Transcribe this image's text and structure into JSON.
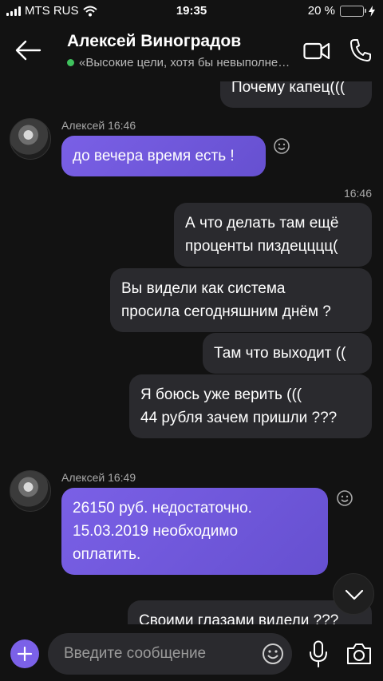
{
  "status_bar": {
    "carrier": "MTS RUS",
    "time": "19:35",
    "battery_percent_label": "20 %",
    "battery_level": 0.2
  },
  "header": {
    "contact_name": "Алексей Виноградов",
    "status_text": "«Высокие цели, хотя бы невыполне…",
    "online_color": "#3fc15d"
  },
  "messages": [
    {
      "direction": "outgoing",
      "text": "Почему капец((("
    },
    {
      "direction": "incoming",
      "sender": "Алексей",
      "time": "16:46",
      "text": "до вечера время есть !"
    },
    {
      "direction": "outgoing",
      "time": "16:46",
      "text": "А что делать там ещё\nпроценты пиздецццц("
    },
    {
      "direction": "outgoing",
      "text": "Вы видели как система\nпросила сегодняшним днём ?"
    },
    {
      "direction": "outgoing",
      "text": "Там что выходит (("
    },
    {
      "direction": "outgoing",
      "text": "Я боюсь уже верить (((\n44 рубля зачем пришли ???"
    },
    {
      "direction": "incoming",
      "sender": "Алексей",
      "time": "16:49",
      "text": "26150 руб. недостаточно.\n15.03.2019 необходимо\nоплатить."
    },
    {
      "direction": "outgoing",
      "text": "Своими глазами видели ???"
    }
  ],
  "composer": {
    "placeholder": "Введите сообщение"
  },
  "colors": {
    "accent": "#7b61e8",
    "incoming_bubble": "#6f58dc",
    "outgoing_bubble": "#2a2a2e",
    "background": "#121212"
  },
  "icons": [
    "back-arrow-icon",
    "video-call-icon",
    "phone-icon",
    "smiley-icon",
    "chevron-down-icon",
    "plus-icon",
    "emoji-icon",
    "microphone-icon",
    "camera-icon",
    "wifi-icon",
    "charging-icon"
  ]
}
